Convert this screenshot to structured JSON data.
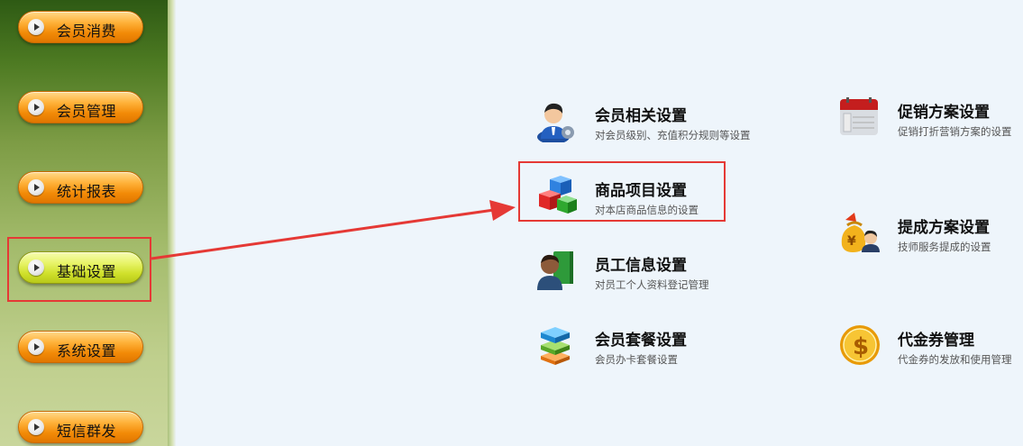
{
  "sidebar": {
    "items": [
      {
        "label": "会员消费"
      },
      {
        "label": "会员管理"
      },
      {
        "label": "统计报表"
      },
      {
        "label": "基础设置"
      },
      {
        "label": "系统设置"
      },
      {
        "label": "短信群发"
      }
    ],
    "active_item": "基础设置"
  },
  "settings": {
    "member": {
      "title": "会员相关设置",
      "desc": "对会员级别、充值积分规则等设置",
      "icon": "member-settings-icon"
    },
    "product": {
      "title": "商品项目设置",
      "desc": "对本店商品信息的设置",
      "icon": "product-cubes-icon"
    },
    "staff": {
      "title": "员工信息设置",
      "desc": "对员工个人资料登记管理",
      "icon": "staff-book-icon"
    },
    "package": {
      "title": "会员套餐设置",
      "desc": "会员办卡套餐设置",
      "icon": "package-stack-icon"
    },
    "promotion": {
      "title": "促销方案设置",
      "desc": "促销打折营销方案的设置",
      "icon": "calendar-icon"
    },
    "commission": {
      "title": "提成方案设置",
      "desc": "技师服务提成的设置",
      "icon": "money-bag-icon"
    },
    "voucher": {
      "title": "代金券管理",
      "desc": "代金券的发放和使用管理",
      "icon": "dollar-coin-icon"
    }
  },
  "colors": {
    "highlight": "#e53935",
    "button_orange": "#f28a07",
    "button_active": "#cfe02a"
  }
}
